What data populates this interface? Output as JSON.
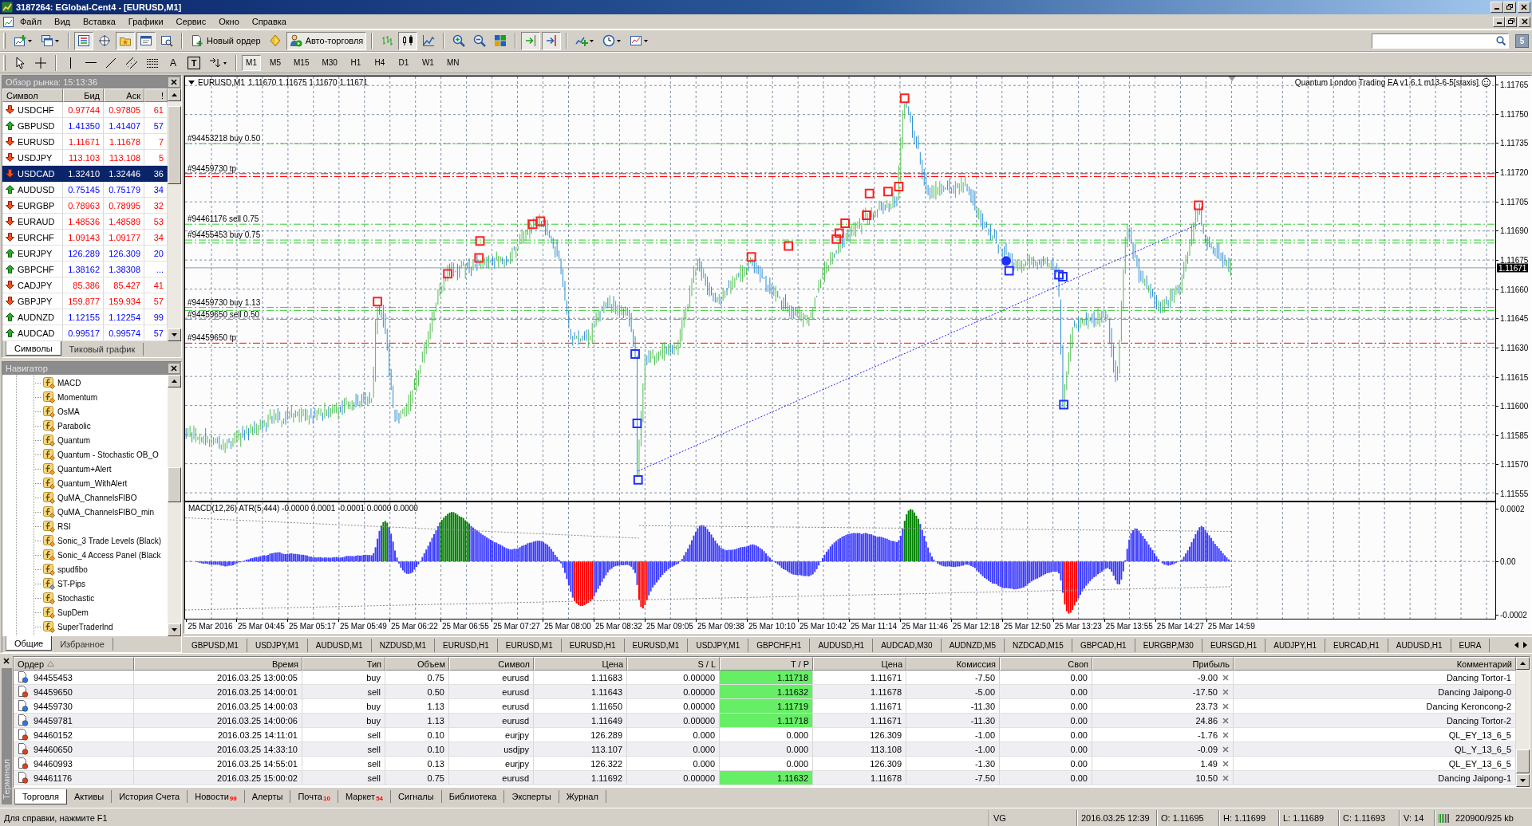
{
  "window": {
    "title": "3187264: EGlobal-Cent4 - [EURUSD,M1]"
  },
  "menu": [
    "Файл",
    "Вид",
    "Вставка",
    "Графики",
    "Сервис",
    "Окно",
    "Справка"
  ],
  "toolbar": {
    "new_order": "Новый ордер",
    "auto_trading": {
      "label": "Авто-торговля",
      "on": true
    },
    "community_button": "5",
    "toggles": {
      "market_watch": true,
      "data_window": false,
      "navigator": true,
      "terminal": true,
      "tester": false,
      "bar_chart": false,
      "candlesticks": true,
      "line_chart": false,
      "chart_shift": true,
      "auto_scroll": true
    }
  },
  "drawing_toolbar": {
    "text_tool": "A",
    "label_tool": "T",
    "timeframes": [
      {
        "label": "M1",
        "selected": true
      },
      {
        "label": "M5",
        "selected": false
      },
      {
        "label": "M15",
        "selected": false
      },
      {
        "label": "M30",
        "selected": false
      },
      {
        "label": "H1",
        "selected": false
      },
      {
        "label": "H4",
        "selected": false
      },
      {
        "label": "D1",
        "selected": false
      },
      {
        "label": "W1",
        "selected": false
      },
      {
        "label": "MN",
        "selected": false
      }
    ]
  },
  "market_watch": {
    "title": "Обзор рынка: 15:13:36",
    "columns": [
      "Символ",
      "Бид",
      "Аск",
      "!"
    ],
    "rows": [
      {
        "symbol": "USDCHF",
        "bid": "0.97744",
        "ask": "0.97805",
        "spread": "61",
        "kind": "down",
        "selected": false
      },
      {
        "symbol": "GBPUSD",
        "bid": "1.41350",
        "ask": "1.41407",
        "spread": "57",
        "kind": "up",
        "selected": false
      },
      {
        "symbol": "EURUSD",
        "bid": "1.11671",
        "ask": "1.11678",
        "spread": "7",
        "kind": "down",
        "selected": false
      },
      {
        "symbol": "USDJPY",
        "bid": "113.103",
        "ask": "113.108",
        "spread": "5",
        "kind": "down",
        "selected": false
      },
      {
        "symbol": "USDCAD",
        "bid": "1.32410",
        "ask": "1.32446",
        "spread": "36",
        "kind": "down",
        "selected": true
      },
      {
        "symbol": "AUDUSD",
        "bid": "0.75145",
        "ask": "0.75179",
        "spread": "34",
        "kind": "up",
        "selected": false
      },
      {
        "symbol": "EURGBP",
        "bid": "0.78963",
        "ask": "0.78995",
        "spread": "32",
        "kind": "down",
        "selected": false
      },
      {
        "symbol": "EURAUD",
        "bid": "1.48536",
        "ask": "1.48589",
        "spread": "53",
        "kind": "down",
        "selected": false
      },
      {
        "symbol": "EURCHF",
        "bid": "1.09143",
        "ask": "1.09177",
        "spread": "34",
        "kind": "down",
        "selected": false
      },
      {
        "symbol": "EURJPY",
        "bid": "126.289",
        "ask": "126.309",
        "spread": "20",
        "kind": "up",
        "selected": false
      },
      {
        "symbol": "GBPCHF",
        "bid": "1.38162",
        "ask": "1.38308",
        "spread": "...",
        "kind": "up",
        "selected": false
      },
      {
        "symbol": "CADJPY",
        "bid": "85.386",
        "ask": "85.427",
        "spread": "41",
        "kind": "down",
        "selected": false
      },
      {
        "symbol": "GBPJPY",
        "bid": "159.877",
        "ask": "159.934",
        "spread": "57",
        "kind": "down",
        "selected": false
      },
      {
        "symbol": "AUDNZD",
        "bid": "1.12155",
        "ask": "1.12254",
        "spread": "99",
        "kind": "up",
        "selected": false
      },
      {
        "symbol": "AUDCAD",
        "bid": "0.99517",
        "ask": "0.99574",
        "spread": "57",
        "kind": "up",
        "selected": false
      }
    ],
    "tabs": [
      {
        "label": "Символы",
        "selected": true
      },
      {
        "label": "Тиковый график",
        "selected": false
      }
    ]
  },
  "navigator": {
    "title": "Навигатор",
    "items": [
      {
        "label": "MACD",
        "kind": "source"
      },
      {
        "label": "Momentum",
        "kind": "source"
      },
      {
        "label": "OsMA",
        "kind": "source"
      },
      {
        "label": "Parabolic",
        "kind": "source"
      },
      {
        "label": "Quantum",
        "kind": "source"
      },
      {
        "label": "Quantum - Stochastic OB_O",
        "kind": "source"
      },
      {
        "label": "Quantum+Alert",
        "kind": "source"
      },
      {
        "label": "Quantum_WithAlert",
        "kind": "source"
      },
      {
        "label": "QuMA_ChannelsFIBO",
        "kind": "source"
      },
      {
        "label": "QuMA_ChannelsFIBO_min",
        "kind": "source"
      },
      {
        "label": "RSI",
        "kind": "source"
      },
      {
        "label": "Sonic_3 Trade Levels (Black)",
        "kind": "source"
      },
      {
        "label": "Sonic_4 Access Panel (Black",
        "kind": "source"
      },
      {
        "label": "spudfibo",
        "kind": "source"
      },
      {
        "label": "ST-Pips",
        "kind": "binary"
      },
      {
        "label": "Stochastic",
        "kind": "source"
      },
      {
        "label": "SupDem",
        "kind": "source"
      },
      {
        "label": "SuperTraderInd",
        "kind": "source"
      }
    ],
    "tabs": [
      {
        "label": "Общие",
        "selected": true
      },
      {
        "label": "Избранное",
        "selected": false
      }
    ]
  },
  "chart": {
    "symbol": "EURUSD,M1",
    "ohlc": "1.11670 1.11675 1.11670 1.11671",
    "expert": "Quantum London Trading EA v1.6.1 m13-6-5[staxis]",
    "price_ticks": [
      "1.11765",
      "1.11750",
      "1.11735",
      "1.11720",
      "1.11705",
      "1.11690",
      "1.11675",
      "1.11660",
      "1.11645",
      "1.11630",
      "1.11615",
      "1.11600",
      "1.11585",
      "1.11570",
      "1.11555"
    ],
    "current_price": "1.11671",
    "order_lines": [
      {
        "label": "#94453218 buy 0.50",
        "kind": "entry"
      },
      {
        "label": "#94459730 tp",
        "kind": "tp"
      },
      {
        "label": "#94461176 sell 0.75",
        "kind": "entry"
      },
      {
        "label": "#94455453 buy 0.75",
        "kind": "entry"
      },
      {
        "label": "#94459730 buy 1.13",
        "kind": "entry"
      },
      {
        "label": "#94459650 sell 0.50",
        "kind": "entry"
      },
      {
        "label": "#94459650 tp",
        "kind": "tp"
      }
    ],
    "indicator": {
      "title": "MACD(12,26) ATR(5,444) -0.0000 0.0001 -0.0001 0.0000 0.0000",
      "ticks": [
        "0.0002",
        "0.00",
        "-0.0002"
      ]
    },
    "time_ticks": [
      "25 Mar 2016",
      "25 Mar 04:45",
      "25 Mar 05:17",
      "25 Mar 05:49",
      "25 Mar 06:22",
      "25 Mar 06:55",
      "25 Mar 07:27",
      "25 Mar 08:00",
      "25 Mar 08:32",
      "25 Mar 09:05",
      "25 Mar 09:38",
      "25 Mar 10:10",
      "25 Mar 10:42",
      "25 Mar 11:14",
      "25 Mar 11:46",
      "25 Mar 12:18",
      "25 Mar 12:50",
      "25 Mar 13:23",
      "25 Mar 13:55",
      "25 Mar 14:27",
      "25 Mar 14:59"
    ]
  },
  "chart_tabs": [
    "GBPUSD,M1",
    "USDJPY,M1",
    "AUDUSD,M1",
    "NZDUSD,M1",
    "EURUSD,H1",
    "EURUSD,M1",
    "EURUSD,H1",
    "EURUSD,M1",
    "USDJPY,M1",
    "GBPCHF,H1",
    "AUDUSD,H1",
    "AUDCAD,M30",
    "AUDNZD,M5",
    "NZDCAD,M15",
    "GBPCAD,H1",
    "EURGBP,M30",
    "EURSGD,H1",
    "AUDJPY,H1",
    "EURCAD,H1",
    "AUDUSD,H1",
    "EURA"
  ],
  "terminal": {
    "label": "Терминал",
    "columns": [
      "Ордер",
      "Время",
      "Тип",
      "Объем",
      "Символ",
      "Цена",
      "S / L",
      "T / P",
      "Цена",
      "Комиссия",
      "Своп",
      "Прибыль",
      "Комментарий"
    ],
    "rows": [
      {
        "kind": "buy",
        "tp_highlight": true,
        "cells": [
          "94455453",
          "2016.03.25 13:00:05",
          "buy",
          "0.75",
          "eurusd",
          "1.11683",
          "0.00000",
          "1.11718",
          "1.11671",
          "-7.50",
          "0.00",
          "-9.00",
          "Dancing Tortor-1"
        ]
      },
      {
        "kind": "sell",
        "tp_highlight": true,
        "cells": [
          "94459650",
          "2016.03.25 14:00:01",
          "sell",
          "0.50",
          "eurusd",
          "1.11643",
          "0.00000",
          "1.11632",
          "1.11678",
          "-5.00",
          "0.00",
          "-17.50",
          "Dancing Jaipong-0"
        ]
      },
      {
        "kind": "buy",
        "tp_highlight": true,
        "cells": [
          "94459730",
          "2016.03.25 14:00:03",
          "buy",
          "1.13",
          "eurusd",
          "1.11650",
          "0.00000",
          "1.11719",
          "1.11671",
          "-11.30",
          "0.00",
          "23.73",
          "Dancing Keroncong-2"
        ]
      },
      {
        "kind": "buy",
        "tp_highlight": true,
        "cells": [
          "94459781",
          "2016.03.25 14:00:06",
          "buy",
          "1.13",
          "eurusd",
          "1.11649",
          "0.00000",
          "1.11718",
          "1.11671",
          "-11.30",
          "0.00",
          "24.86",
          "Dancing Tortor-2"
        ]
      },
      {
        "kind": "sell",
        "tp_highlight": false,
        "cells": [
          "94460152",
          "2016.03.25 14:11:01",
          "sell",
          "0.10",
          "eurjpy",
          "126.289",
          "0.000",
          "0.000",
          "126.309",
          "-1.00",
          "0.00",
          "-1.76",
          "QL_EY_13_6_5"
        ]
      },
      {
        "kind": "sell",
        "tp_highlight": false,
        "cells": [
          "94460650",
          "2016.03.25 14:33:10",
          "sell",
          "0.10",
          "usdjpy",
          "113.107",
          "0.000",
          "0.000",
          "113.108",
          "-1.00",
          "0.00",
          "-0.09",
          "QL_Y_13_6_5"
        ]
      },
      {
        "kind": "sell",
        "tp_highlight": false,
        "cells": [
          "94460993",
          "2016.03.25 14:55:01",
          "sell",
          "0.13",
          "eurjpy",
          "126.322",
          "0.000",
          "0.000",
          "126.309",
          "-1.30",
          "0.00",
          "1.49",
          "QL_EY_13_6_5"
        ]
      },
      {
        "kind": "sell",
        "tp_highlight": true,
        "cells": [
          "94461176",
          "2016.03.25 15:00:02",
          "sell",
          "0.75",
          "eurusd",
          "1.11692",
          "0.00000",
          "1.11632",
          "1.11678",
          "-7.50",
          "0.00",
          "10.50",
          "Dancing Jaipong-1"
        ]
      }
    ],
    "tabs": [
      {
        "label": "Торговля",
        "selected": true
      },
      {
        "label": "Активы",
        "selected": false
      },
      {
        "label": "История Счета",
        "selected": false
      },
      {
        "label": "Новости",
        "badge": "99",
        "selected": false
      },
      {
        "label": "Алерты",
        "selected": false
      },
      {
        "label": "Почта",
        "badge": "10",
        "selected": false
      },
      {
        "label": "Маркет",
        "badge": "54",
        "selected": false
      },
      {
        "label": "Сигналы",
        "selected": false
      },
      {
        "label": "Библиотека",
        "selected": false
      },
      {
        "label": "Эксперты",
        "selected": false
      },
      {
        "label": "Журнал",
        "selected": false
      }
    ]
  },
  "status_bar": {
    "help": "Для справки, нажмите F1",
    "profile": "VG",
    "time": "2016.03.25 12:39",
    "open": "O: 1.11695",
    "high": "H: 1.11699",
    "low": "L: 1.11689",
    "close": "C: 1.11693",
    "volume": "V: 14",
    "traffic": "220900/925 kb"
  }
}
